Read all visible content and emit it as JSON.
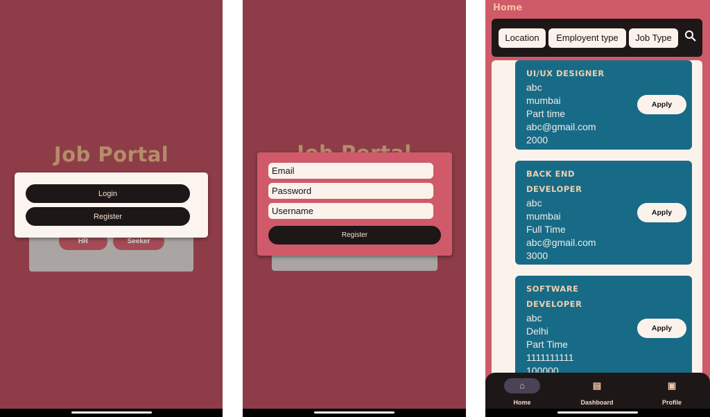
{
  "screen1": {
    "title": "Job Portal",
    "login": "Login",
    "register": "Register",
    "hr": "HR",
    "seeker": "Seeker"
  },
  "screen2": {
    "title": "Job Portal",
    "email_placeholder": "Email",
    "password_placeholder": "Password",
    "username_placeholder": "Username",
    "register": "Register"
  },
  "screen3": {
    "header": "Home",
    "filters": [
      "Location",
      "Employent type",
      "Job Type"
    ],
    "search_icon": "search-icon",
    "jobs": [
      {
        "title": "UI/UX DESIGNER",
        "company": "abc",
        "location": "mumbai",
        "type": "Part time",
        "contact": "abc@gmail.com",
        "salary": "2000",
        "apply": "Apply"
      },
      {
        "title": "BACK END DEVELOPER",
        "company": "abc",
        "location": "mumbai",
        "type": "Full Time",
        "contact": "abc@gmail.com",
        "salary": "3000",
        "apply": "Apply"
      },
      {
        "title": "SOFTWARE DEVELOPER",
        "company": "abc",
        "location": "Delhi",
        "type": "Part Time",
        "contact": "1111111111",
        "salary": "100000",
        "apply": "Apply"
      }
    ],
    "nav": [
      {
        "label": "Home",
        "icon": "home-icon",
        "active": true
      },
      {
        "label": "Dashboard",
        "icon": "briefcase-icon"
      },
      {
        "label": "Profile",
        "icon": "profile-icon"
      }
    ]
  },
  "colors": {
    "bg1": "#8e3d48",
    "accent_pink": "#d05a6a",
    "dark": "#1e1718",
    "teal": "#176b87",
    "cream": "#fbf2ec"
  }
}
